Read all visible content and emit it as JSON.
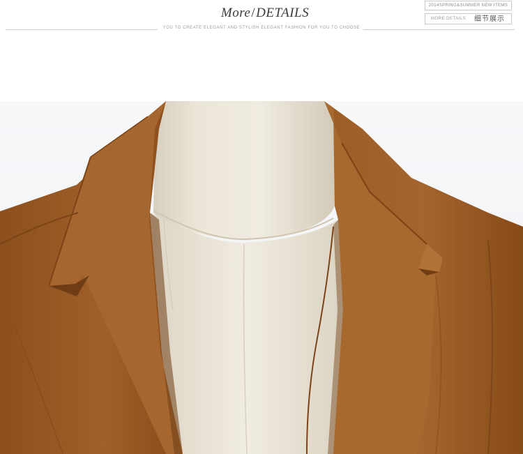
{
  "header": {
    "title_more": "More",
    "title_separator": "/",
    "title_details": "DETAILS",
    "subtitle": "YOU TO CREATE ELEGANT AND STYLISH ELEGANT FASHION FOR YOU TO CHOOSE"
  },
  "tags": {
    "season": "2014SPRING&SUMMER NEW ITEMS",
    "details_en": "MORE DETAILS",
    "details_cn": "细节展示"
  },
  "photo": {
    "subject": "photo",
    "colors": {
      "jacket": "#9a5a22",
      "jacket_shadow": "#6e3d14",
      "mannequin": "#e8e1d2",
      "background": "#f5f6f8"
    }
  }
}
